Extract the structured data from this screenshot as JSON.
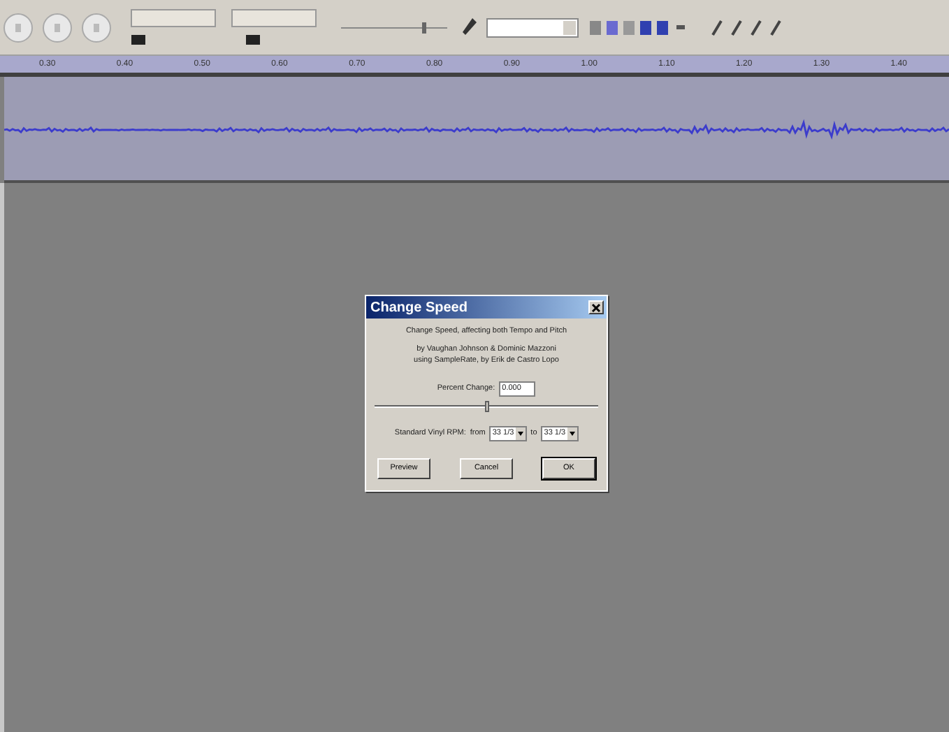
{
  "ruler": {
    "ticks": [
      "0.30",
      "0.40",
      "0.50",
      "0.60",
      "0.70",
      "0.80",
      "0.90",
      "1.00",
      "1.10",
      "1.20",
      "1.30",
      "1.40"
    ]
  },
  "dialog": {
    "title": "Change Speed",
    "description": "Change Speed, affecting both Tempo and Pitch",
    "credits": "by Vaughan Johnson & Dominic Mazzoni\nusing SampleRate, by Erik de Castro Lopo",
    "percent_change": {
      "label": "Percent Change:",
      "value": "0.000"
    },
    "slider": {
      "level": 0.5
    },
    "rpm": {
      "label": "Standard Vinyl RPM:",
      "from_label": "from",
      "from_value": "33 1/3",
      "to_label": "to",
      "to_value": "33 1/3"
    },
    "buttons": [
      {
        "label": "Preview",
        "default": false
      },
      {
        "label": "Cancel",
        "default": false
      },
      {
        "label": "OK",
        "default": true
      }
    ]
  }
}
